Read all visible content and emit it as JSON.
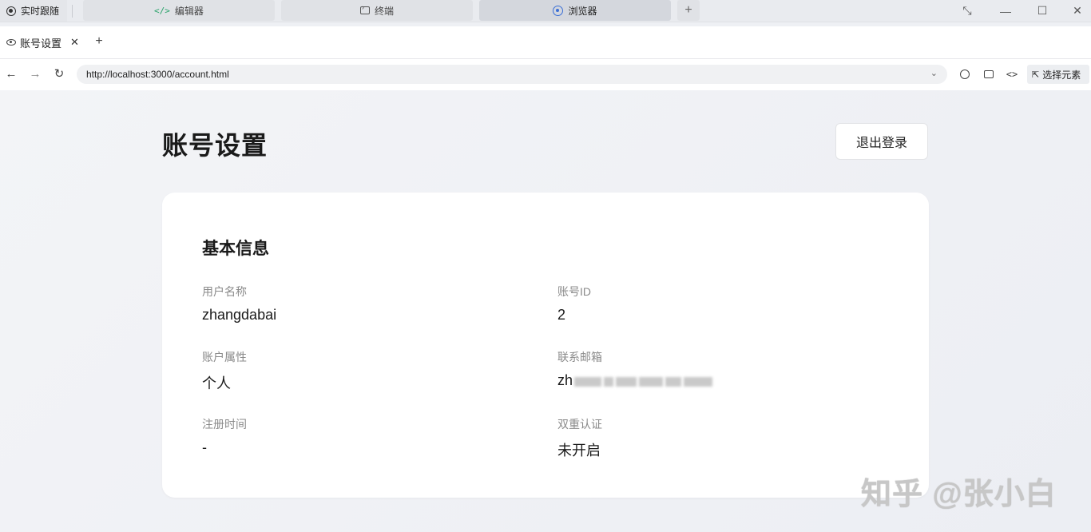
{
  "appbar": {
    "follow_label": "实时跟随",
    "tabs": [
      {
        "label": "编辑器",
        "icon": "code-icon"
      },
      {
        "label": "终端",
        "icon": "terminal-icon"
      },
      {
        "label": "浏览器",
        "icon": "compass-icon",
        "active": true
      }
    ],
    "add_tab": "+"
  },
  "browser": {
    "tab_title": "账号设置",
    "tab_close": "✕",
    "new_tab": "+",
    "url": "http://localhost:3000/account.html",
    "pick_element": "选择元素"
  },
  "page": {
    "title": "账号设置",
    "logout_label": "退出登录",
    "section_title": "基本信息",
    "fields": [
      {
        "label": "用户名称",
        "value": "zhangdabai"
      },
      {
        "label": "账号ID",
        "value": "2"
      },
      {
        "label": "账户属性",
        "value": "个人"
      },
      {
        "label": "联系邮箱",
        "value": "zh"
      },
      {
        "label": "注册时间",
        "value": "-"
      },
      {
        "label": "双重认证",
        "value": "未开启"
      }
    ]
  },
  "watermark": "知乎 @张小白",
  "colors": {
    "accent": "#3b6fd6",
    "code_icon": "#2ba36b",
    "page_bg": "#eef0f4",
    "card_bg": "#ffffff"
  }
}
